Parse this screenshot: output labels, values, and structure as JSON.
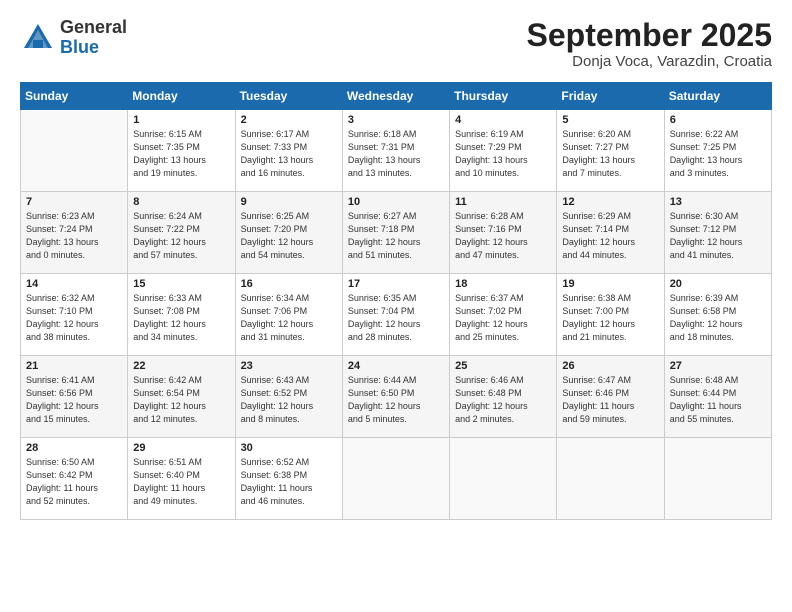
{
  "logo": {
    "general": "General",
    "blue": "Blue"
  },
  "title": "September 2025",
  "location": "Donja Voca, Varazdin, Croatia",
  "days_of_week": [
    "Sunday",
    "Monday",
    "Tuesday",
    "Wednesday",
    "Thursday",
    "Friday",
    "Saturday"
  ],
  "weeks": [
    [
      {
        "day": "",
        "info": ""
      },
      {
        "day": "1",
        "info": "Sunrise: 6:15 AM\nSunset: 7:35 PM\nDaylight: 13 hours\nand 19 minutes."
      },
      {
        "day": "2",
        "info": "Sunrise: 6:17 AM\nSunset: 7:33 PM\nDaylight: 13 hours\nand 16 minutes."
      },
      {
        "day": "3",
        "info": "Sunrise: 6:18 AM\nSunset: 7:31 PM\nDaylight: 13 hours\nand 13 minutes."
      },
      {
        "day": "4",
        "info": "Sunrise: 6:19 AM\nSunset: 7:29 PM\nDaylight: 13 hours\nand 10 minutes."
      },
      {
        "day": "5",
        "info": "Sunrise: 6:20 AM\nSunset: 7:27 PM\nDaylight: 13 hours\nand 7 minutes."
      },
      {
        "day": "6",
        "info": "Sunrise: 6:22 AM\nSunset: 7:25 PM\nDaylight: 13 hours\nand 3 minutes."
      }
    ],
    [
      {
        "day": "7",
        "info": "Sunrise: 6:23 AM\nSunset: 7:24 PM\nDaylight: 13 hours\nand 0 minutes."
      },
      {
        "day": "8",
        "info": "Sunrise: 6:24 AM\nSunset: 7:22 PM\nDaylight: 12 hours\nand 57 minutes."
      },
      {
        "day": "9",
        "info": "Sunrise: 6:25 AM\nSunset: 7:20 PM\nDaylight: 12 hours\nand 54 minutes."
      },
      {
        "day": "10",
        "info": "Sunrise: 6:27 AM\nSunset: 7:18 PM\nDaylight: 12 hours\nand 51 minutes."
      },
      {
        "day": "11",
        "info": "Sunrise: 6:28 AM\nSunset: 7:16 PM\nDaylight: 12 hours\nand 47 minutes."
      },
      {
        "day": "12",
        "info": "Sunrise: 6:29 AM\nSunset: 7:14 PM\nDaylight: 12 hours\nand 44 minutes."
      },
      {
        "day": "13",
        "info": "Sunrise: 6:30 AM\nSunset: 7:12 PM\nDaylight: 12 hours\nand 41 minutes."
      }
    ],
    [
      {
        "day": "14",
        "info": "Sunrise: 6:32 AM\nSunset: 7:10 PM\nDaylight: 12 hours\nand 38 minutes."
      },
      {
        "day": "15",
        "info": "Sunrise: 6:33 AM\nSunset: 7:08 PM\nDaylight: 12 hours\nand 34 minutes."
      },
      {
        "day": "16",
        "info": "Sunrise: 6:34 AM\nSunset: 7:06 PM\nDaylight: 12 hours\nand 31 minutes."
      },
      {
        "day": "17",
        "info": "Sunrise: 6:35 AM\nSunset: 7:04 PM\nDaylight: 12 hours\nand 28 minutes."
      },
      {
        "day": "18",
        "info": "Sunrise: 6:37 AM\nSunset: 7:02 PM\nDaylight: 12 hours\nand 25 minutes."
      },
      {
        "day": "19",
        "info": "Sunrise: 6:38 AM\nSunset: 7:00 PM\nDaylight: 12 hours\nand 21 minutes."
      },
      {
        "day": "20",
        "info": "Sunrise: 6:39 AM\nSunset: 6:58 PM\nDaylight: 12 hours\nand 18 minutes."
      }
    ],
    [
      {
        "day": "21",
        "info": "Sunrise: 6:41 AM\nSunset: 6:56 PM\nDaylight: 12 hours\nand 15 minutes."
      },
      {
        "day": "22",
        "info": "Sunrise: 6:42 AM\nSunset: 6:54 PM\nDaylight: 12 hours\nand 12 minutes."
      },
      {
        "day": "23",
        "info": "Sunrise: 6:43 AM\nSunset: 6:52 PM\nDaylight: 12 hours\nand 8 minutes."
      },
      {
        "day": "24",
        "info": "Sunrise: 6:44 AM\nSunset: 6:50 PM\nDaylight: 12 hours\nand 5 minutes."
      },
      {
        "day": "25",
        "info": "Sunrise: 6:46 AM\nSunset: 6:48 PM\nDaylight: 12 hours\nand 2 minutes."
      },
      {
        "day": "26",
        "info": "Sunrise: 6:47 AM\nSunset: 6:46 PM\nDaylight: 11 hours\nand 59 minutes."
      },
      {
        "day": "27",
        "info": "Sunrise: 6:48 AM\nSunset: 6:44 PM\nDaylight: 11 hours\nand 55 minutes."
      }
    ],
    [
      {
        "day": "28",
        "info": "Sunrise: 6:50 AM\nSunset: 6:42 PM\nDaylight: 11 hours\nand 52 minutes."
      },
      {
        "day": "29",
        "info": "Sunrise: 6:51 AM\nSunset: 6:40 PM\nDaylight: 11 hours\nand 49 minutes."
      },
      {
        "day": "30",
        "info": "Sunrise: 6:52 AM\nSunset: 6:38 PM\nDaylight: 11 hours\nand 46 minutes."
      },
      {
        "day": "",
        "info": ""
      },
      {
        "day": "",
        "info": ""
      },
      {
        "day": "",
        "info": ""
      },
      {
        "day": "",
        "info": ""
      }
    ]
  ]
}
